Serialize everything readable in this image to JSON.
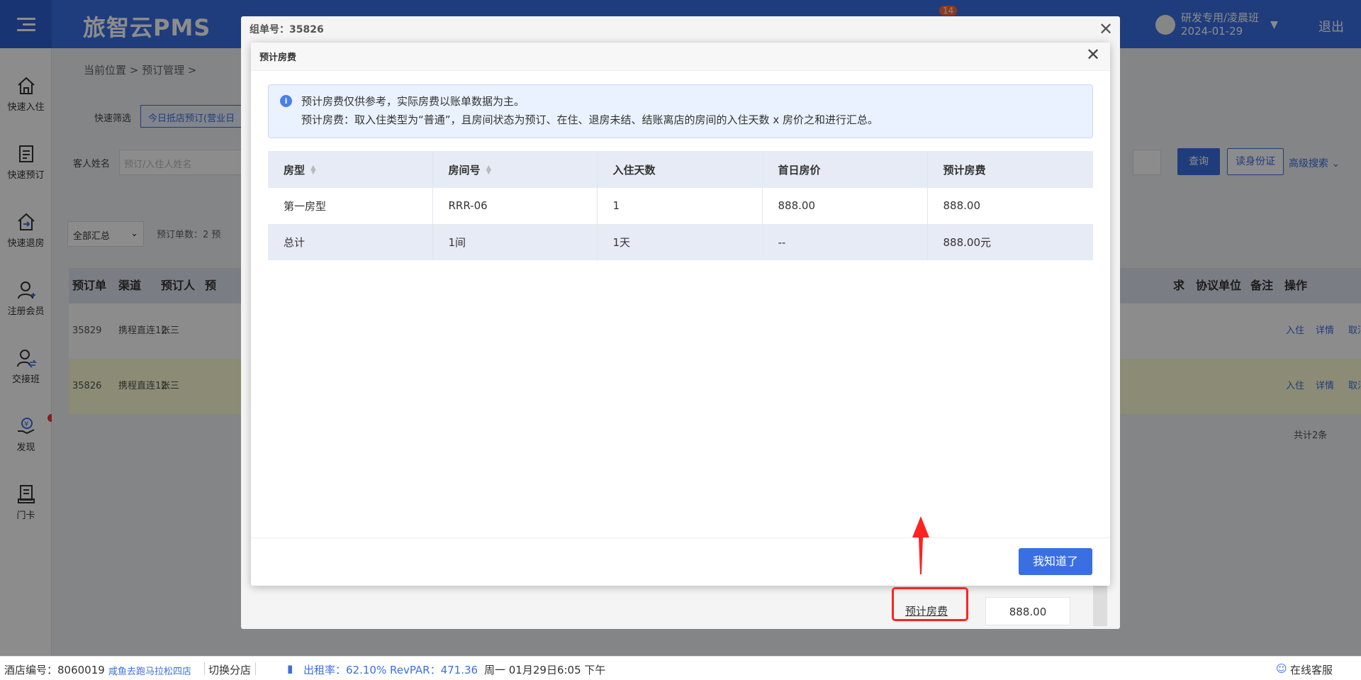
{
  "header": {
    "logo": "旅智云PMS",
    "badge": "14",
    "user_line1": "研发专用/凌晨班",
    "user_line2": "2024-01-29",
    "logout": "退出"
  },
  "sidebar": {
    "items": [
      {
        "label": "快速入住",
        "icon": "home-icon"
      },
      {
        "label": "快速预订",
        "icon": "clipboard-icon"
      },
      {
        "label": "快速退房",
        "icon": "checkout-icon"
      },
      {
        "label": "注册会员",
        "icon": "user-add-icon"
      },
      {
        "label": "交接班",
        "icon": "user-swap-icon"
      },
      {
        "label": "发现",
        "icon": "money-hand-icon"
      },
      {
        "label": "门卡",
        "icon": "card-icon"
      }
    ]
  },
  "page": {
    "breadcrumb": "当前位置  >  预订管理  >",
    "quick_filter_label": "快速筛选",
    "quick_filter_chip": "今日抵店预订(营业日",
    "guest_label": "客人姓名",
    "guest_placeholder": "预订/入住人姓名",
    "query_btn": "查询",
    "read_id_btn": "读身份证",
    "adv_search": "高级搜索",
    "summary_select": "全部汇总",
    "order_count": "预订单数：2   预",
    "grid_headers": [
      "预订单",
      "渠道",
      "预订人",
      "预",
      "求",
      "协议单位",
      "备注",
      "操作"
    ],
    "grid_rows": [
      {
        "id": "35829",
        "channel": "携程直连12",
        "booker": "张三",
        "actions": [
          "入住",
          "详情",
          "取消订单"
        ]
      },
      {
        "id": "35826",
        "channel": "携程直连12",
        "booker": "张三",
        "actions": [
          "入住",
          "详情",
          "取消订单"
        ]
      }
    ],
    "total_rows": "共计2条"
  },
  "outer_modal": {
    "title": "组单号：35826",
    "footer_btn": "预计房费",
    "footer_value": "888.00"
  },
  "inner_modal": {
    "title": "预计房费",
    "notice_line1": "预计房费仅供参考，实际房费以账单数据为主。",
    "notice_line2": "预计房费：取入住类型为“普通”，且房间状态为预订、在住、退房未结、结账离店的房间的入住天数 x 房价之和进行汇总。",
    "columns": [
      "房型",
      "房间号",
      "入住天数",
      "首日房价",
      "预计房费"
    ],
    "rows": [
      [
        "第一房型",
        "RRR-06",
        "1",
        "888.00",
        "888.00"
      ]
    ],
    "total_row": [
      "总计",
      "1间",
      "1天",
      "--",
      "888.00元"
    ],
    "ok_btn": "我知道了"
  },
  "statusbar": {
    "hotel_no_label": "酒店编号：8060019",
    "hotel_name": "咸鱼去跑马拉松四店",
    "switch_branch": "切换分店",
    "occupancy": "出租率：62.10% RevPAR：471.36",
    "datetime": "周一 01月29日6:05 下午",
    "support": "在线客服"
  },
  "colors": {
    "primary": "#3a6fe4",
    "annotation": "#ff2222"
  }
}
